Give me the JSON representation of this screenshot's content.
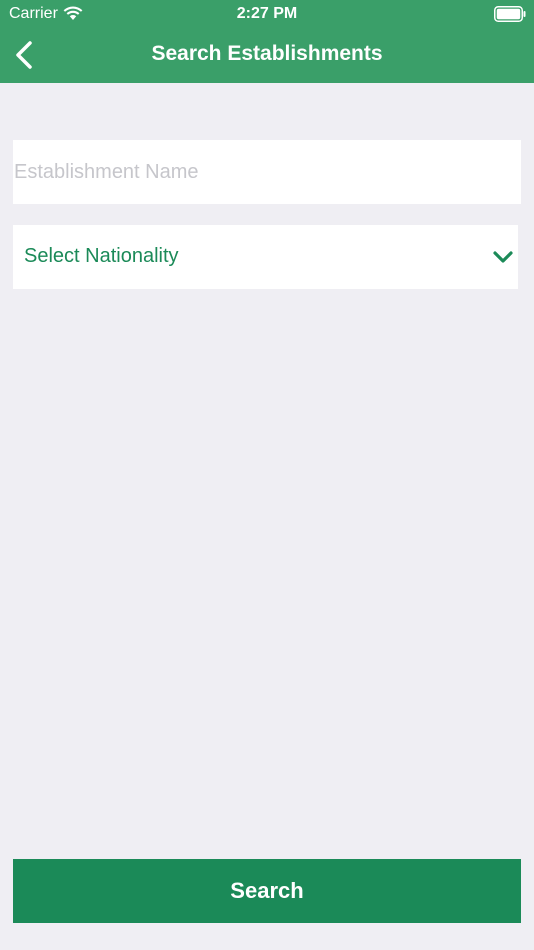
{
  "status_bar": {
    "carrier": "Carrier",
    "time": "2:27 PM",
    "wifi_icon": "wifi-icon",
    "battery_icon": "battery-icon"
  },
  "nav": {
    "title": "Search Establishments",
    "back_icon": "chevron-left-icon"
  },
  "form": {
    "establishment_name": {
      "value": "",
      "placeholder": "Establishment Name"
    },
    "nationality": {
      "selected": "Select Nationality",
      "icon": "chevron-down-icon"
    }
  },
  "actions": {
    "search_label": "Search"
  },
  "colors": {
    "header": "#3a9f69",
    "accent": "#1b8a58",
    "background": "#efeef3",
    "placeholder": "#c6c6cb"
  }
}
